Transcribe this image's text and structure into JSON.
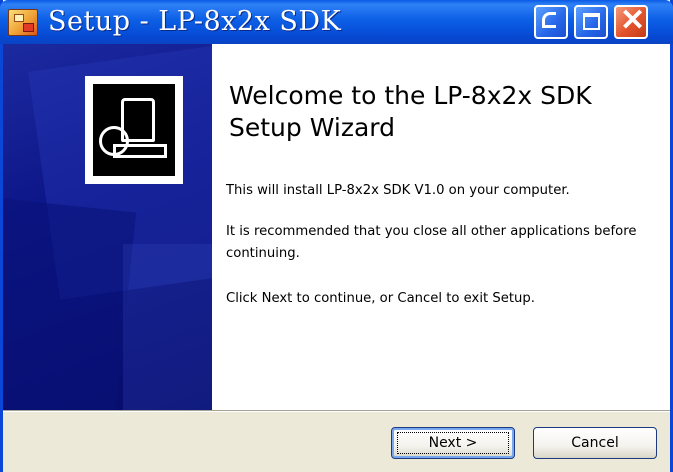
{
  "window": {
    "title": "Setup - LP-8x2x SDK",
    "controls": {
      "minimize": "minimize-icon",
      "maximize": "maximize-icon",
      "close": "close-icon"
    }
  },
  "banner": {
    "icon": "setup-computer-icon"
  },
  "content": {
    "heading": "Welcome to the LP-8x2x SDK Setup Wizard",
    "paragraph1": "This will install LP-8x2x SDK V1.0 on your computer.",
    "paragraph2": "It is recommended that you close all other applications before  continuing.",
    "paragraph3": "Click Next to continue, or Cancel to exit Setup."
  },
  "buttons": {
    "next_label": "Next >",
    "cancel_label": "Cancel"
  },
  "colors": {
    "titlebar": "#0a5ae6",
    "close_button": "#e2532c",
    "banner": "#0d1688",
    "dialog_bg": "#ece9d8"
  }
}
